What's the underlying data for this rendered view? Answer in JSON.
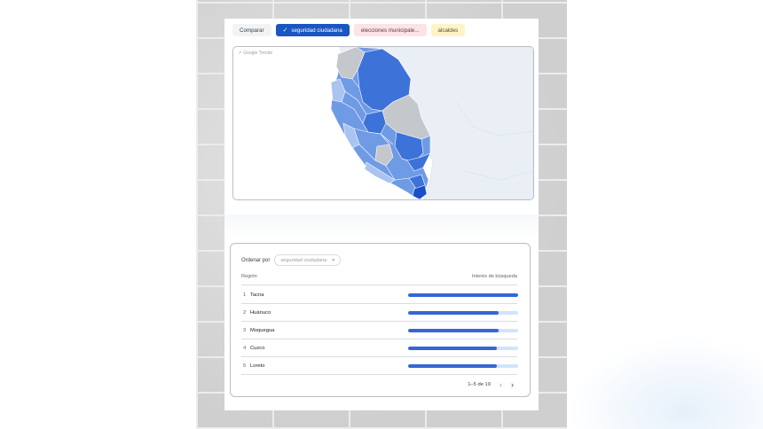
{
  "chips": {
    "compare": "Comparar",
    "seguridad": "seguridad ciudadana",
    "elecciones": "elecciones municipale...",
    "alcaldes": "alcaldes"
  },
  "map": {
    "watermark": "Google Trends",
    "colors": {
      "dark": "#3d72d9",
      "mid": "#6f9be5",
      "light": "#a9c4f1",
      "none": "#c4c7cc",
      "sea": "#ffffff",
      "neighbor": "#eaeff6"
    }
  },
  "table": {
    "order_label": "Ordenar por",
    "order_value": "seguridad ciudadana",
    "col_region": "Región",
    "col_interest": "Interés de búsqueda",
    "rows": [
      {
        "rank": "1",
        "region": "Tacna",
        "interest": 100
      },
      {
        "rank": "2",
        "region": "Huánuco",
        "interest": 82
      },
      {
        "rank": "3",
        "region": "Moquegua",
        "interest": 82
      },
      {
        "rank": "4",
        "region": "Cuzco",
        "interest": 81
      },
      {
        "rank": "5",
        "region": "Loreto",
        "interest": 81
      }
    ],
    "pagination": "1–5 de 19"
  }
}
